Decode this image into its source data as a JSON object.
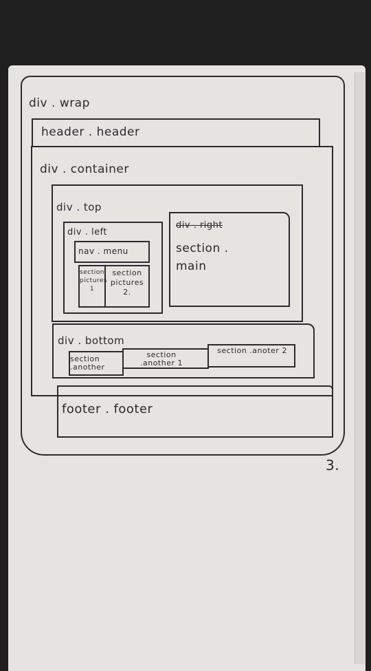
{
  "diagram": {
    "wrap": "div . wrap",
    "header": "header . header",
    "container": "div . container",
    "top": "div . top",
    "left": "div . left",
    "nav": "nav . menu",
    "picture1": "section pictures 1",
    "picture2": "section pictures 2.",
    "right_struck": "div . right",
    "main": "section . main",
    "bottom": "div . bottom",
    "another": "section .another",
    "another1": "section .another 1",
    "another2": "section .anoter 2",
    "footer": "footer . footer",
    "page_number": "3."
  }
}
